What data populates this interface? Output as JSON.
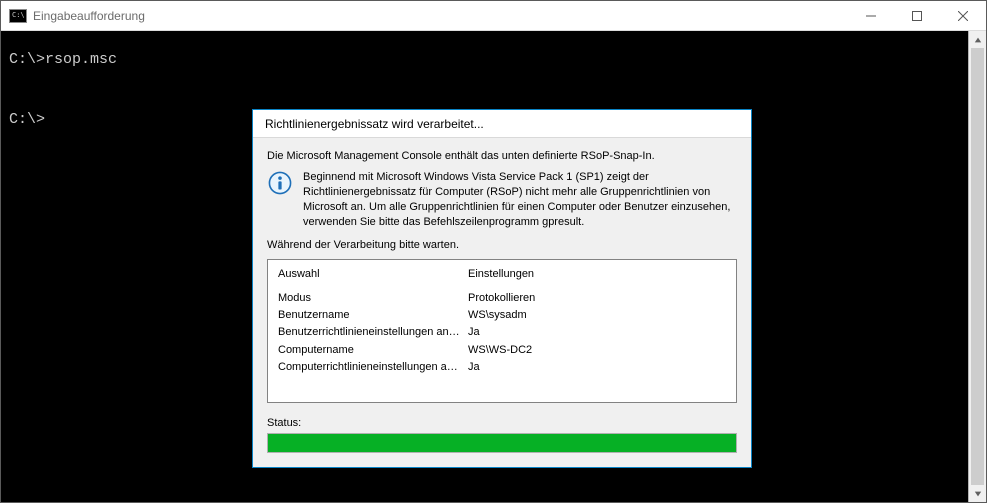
{
  "window": {
    "title": "Eingabeaufforderung"
  },
  "console": {
    "line1_prompt": "C:\\>",
    "line1_cmd": "rsop.msc",
    "line2_prompt": "C:\\>"
  },
  "dialog": {
    "title": "Richtlinienergebnissatz wird verarbeitet...",
    "intro": "Die Microsoft Management Console enthält das unten definierte RSoP-Snap-In.",
    "info": "Beginnend mit Microsoft Windows Vista Service Pack 1 (SP1) zeigt der Richtlinienergebnissatz für Computer (RSoP) nicht mehr alle Gruppenrichtlinien von Microsoft an. Um alle Gruppenrichtlinien für einen Computer oder Benutzer einzusehen, verwenden Sie bitte das Befehlszeilenprogramm gpresult.",
    "wait": "Während der Verarbeitung bitte warten.",
    "table": {
      "header_col1": "Auswahl",
      "header_col2": "Einstellungen",
      "rows": [
        {
          "label": "Modus",
          "value": "Protokollieren"
        },
        {
          "label": "Benutzername",
          "value": "WS\\sysadm"
        },
        {
          "label": "Benutzerrichtlinieneinstellungen anz...",
          "value": "Ja"
        },
        {
          "label": "Computername",
          "value": "WS\\WS-DC2"
        },
        {
          "label": "Computerrichtlinieneinstellungen anz...",
          "value": "Ja"
        }
      ]
    },
    "status_label": "Status:",
    "progress_percent": 100
  }
}
